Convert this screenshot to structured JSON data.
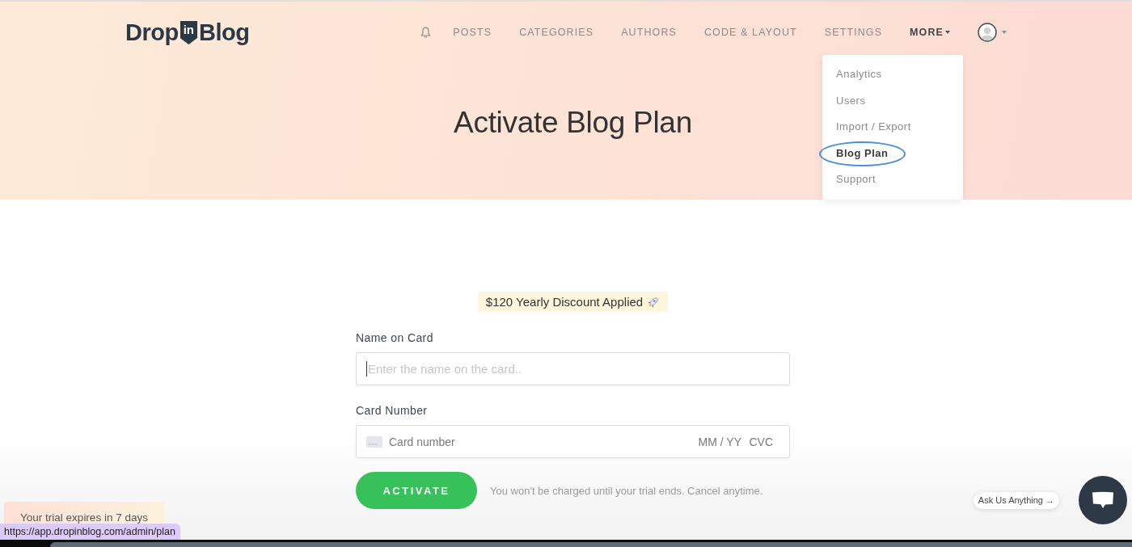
{
  "logo": {
    "word_1": "Drop",
    "badge": "in",
    "word_2": "Blog"
  },
  "nav": {
    "items": [
      {
        "label": "POSTS",
        "kind": "link",
        "selected": false
      },
      {
        "label": "CATEGORIES",
        "kind": "link",
        "selected": false
      },
      {
        "label": "AUTHORS",
        "kind": "link",
        "selected": false
      },
      {
        "label": "CODE & LAYOUT",
        "kind": "link",
        "selected": false
      },
      {
        "label": "SETTINGS",
        "kind": "link",
        "selected": false
      },
      {
        "label": "MORE",
        "kind": "menu",
        "selected": true
      }
    ]
  },
  "dropdown": {
    "items": [
      {
        "label": "Analytics",
        "selected": false,
        "circled": false
      },
      {
        "label": "Users",
        "selected": false,
        "circled": false
      },
      {
        "label": "Import / Export",
        "selected": false,
        "circled": false
      },
      {
        "label": "Blog Plan",
        "selected": true,
        "circled": true
      },
      {
        "label": "Support",
        "selected": false,
        "circled": false
      }
    ]
  },
  "heading": "Activate Blog Plan",
  "form": {
    "discount_badge": "$120 Yearly Discount Applied",
    "fields": [
      {
        "kind": "text",
        "label": "Name on Card",
        "placeholder": "Enter the name on the card..",
        "focused": true
      },
      {
        "kind": "card",
        "label": "Card Number",
        "placeholder": "Card number",
        "expiry_placeholder": "MM / YY",
        "cvc_placeholder": "CVC",
        "focused": false
      }
    ],
    "submit_button": "ACTIVATE",
    "note": "You won't be charged until your trial ends. Cancel anytime."
  },
  "trial_toast": "Your trial expires in 7 days",
  "status_url": "https://app.dropinblog.com/admin/plan",
  "chat": {
    "prompt": "Ask Us Anything →"
  }
}
